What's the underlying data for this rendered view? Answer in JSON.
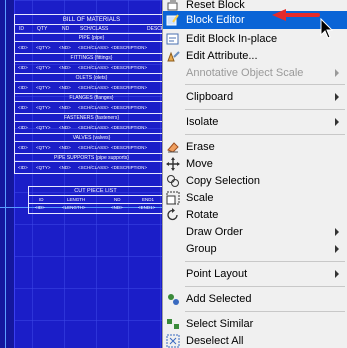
{
  "drawing": {
    "bom_title": "BILL OF MATERIALS",
    "bom_columns": [
      "ID",
      "QTY",
      "ND",
      "SCH/CLASS",
      "DESCR"
    ],
    "bom_sections": [
      "PIPE {pipe}",
      "FITTINGS {fittings}",
      "OLETS {olets}",
      "FLANGES {flanges}",
      "FASTENERS {fasteners}",
      "VALVES {valves}",
      "PIPE SUPPORTS {pipe supports}"
    ],
    "bom_row_cells": [
      "<ID>",
      "<QTY>",
      "<ND>",
      "<SCH/CLASS>",
      "<DESCRIPTION>"
    ],
    "cut_title": "CUT PIECE LIST",
    "cut_columns": [
      "ID",
      "LENGTH",
      "ND",
      "END1"
    ],
    "cut_row_cells": [
      "<ID>",
      "<LENGTH>",
      "<ND>",
      "<END1>"
    ]
  },
  "menu": {
    "items": [
      {
        "label": "Reset Block",
        "icon": "reset-block-icon"
      },
      {
        "label": "Block Editor",
        "icon": "block-editor-icon",
        "highlighted": true
      },
      {
        "label": "Edit Block In-place",
        "icon": "edit-block-inplace-icon"
      },
      {
        "label": "Edit Attribute...",
        "icon": "edit-attribute-icon"
      },
      {
        "label": "Annotative Object Scale",
        "disabled": true,
        "submenu": true
      },
      {
        "label": "Clipboard",
        "submenu": true
      },
      {
        "label": "Isolate",
        "submenu": true
      },
      {
        "label": "Erase",
        "icon": "eraser-icon"
      },
      {
        "label": "Move",
        "icon": "move-icon"
      },
      {
        "label": "Copy Selection",
        "icon": "copy-icon"
      },
      {
        "label": "Scale",
        "icon": "scale-icon"
      },
      {
        "label": "Rotate",
        "icon": "rotate-icon"
      },
      {
        "label": "Draw Order",
        "submenu": true
      },
      {
        "label": "Group",
        "submenu": true
      },
      {
        "label": "Point Layout",
        "submenu": true
      },
      {
        "label": "Add Selected",
        "icon": "add-selected-icon"
      },
      {
        "label": "Select Similar",
        "icon": "select-similar-icon"
      },
      {
        "label": "Deselect All",
        "icon": "deselect-all-icon"
      }
    ]
  },
  "colors": {
    "highlight": "#0a64d6",
    "canvas": "#1b1ec8",
    "annotation_arrow": "#e52b2b"
  }
}
